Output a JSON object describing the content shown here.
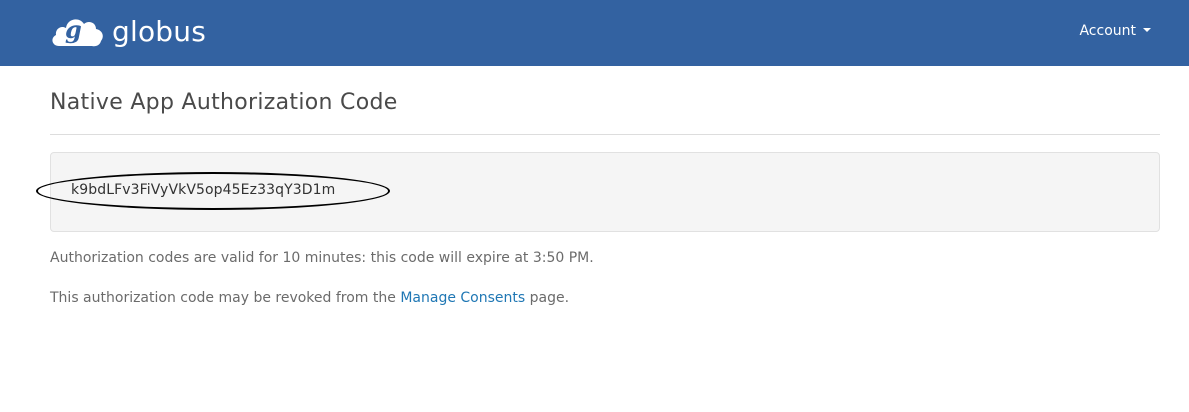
{
  "navbar": {
    "brand_name": "globus",
    "logo_icon": "globus-cloud-logo-icon",
    "account_label": "Account",
    "background_color": "#3362a1"
  },
  "main": {
    "page_title": "Native App Authorization Code",
    "authorization_code": "k9bdLFv3FiVyVkV5op45Ez33qY3D1m",
    "validity_text": "Authorization codes are valid for 10 minutes: this code will expire at 3:50 PM.",
    "revoke_text_before": "This authorization code may be revoked from the ",
    "revoke_link_label": "Manage Consents",
    "revoke_text_after": " page.",
    "link_color": "#1f77b4"
  }
}
